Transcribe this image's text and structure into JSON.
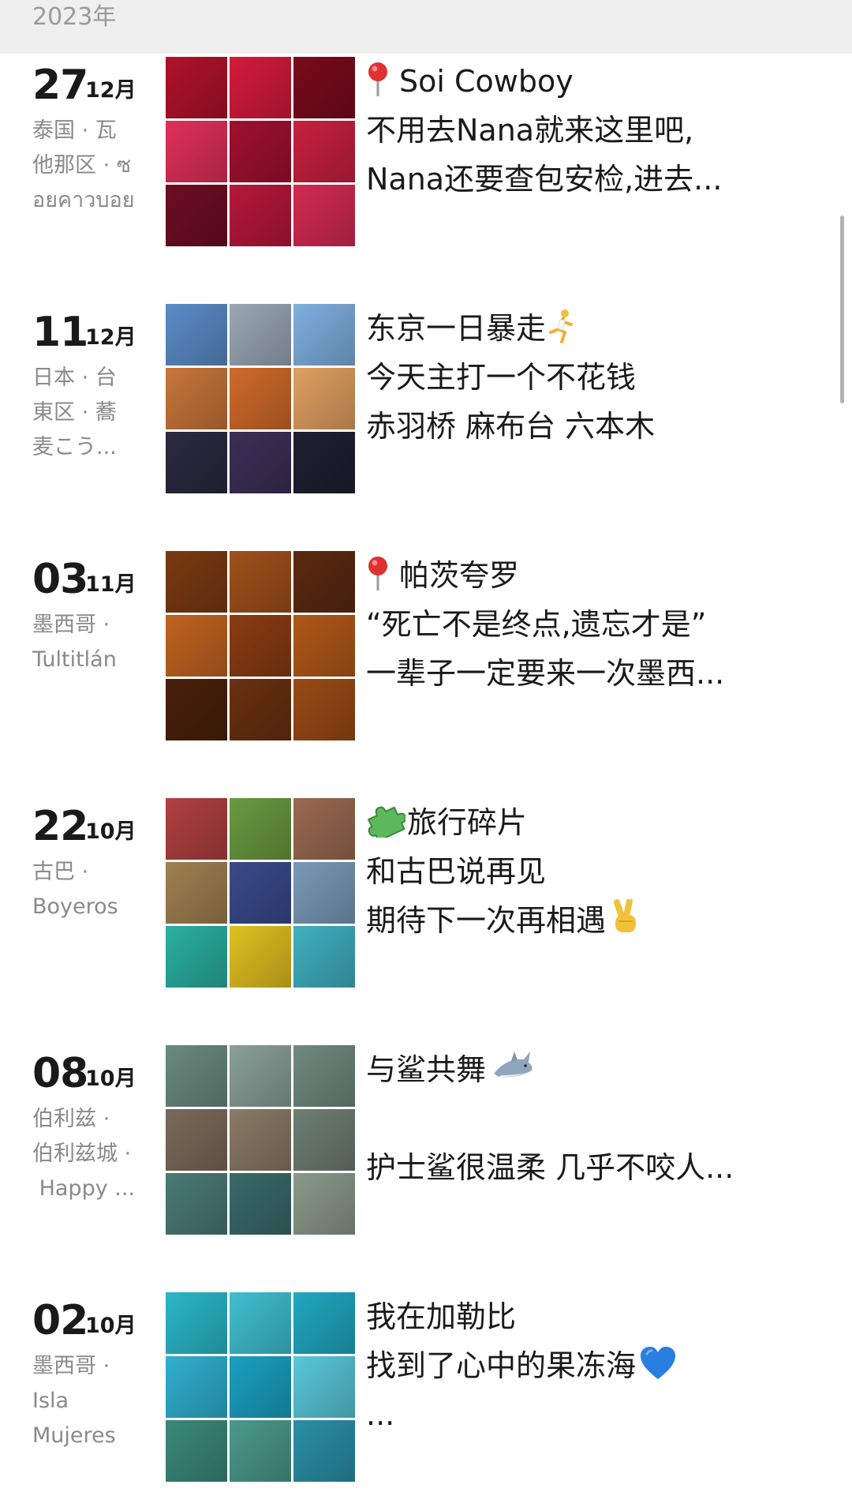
{
  "year_header": "2023年",
  "entries": [
    {
      "day": "27",
      "month": "12月",
      "location": [
        "泰国 · 瓦",
        "他那区 · ซ",
        "อยคาวบอย"
      ],
      "caption": [
        "Soi Cowboy",
        "不用去Nana就来这里吧,",
        "Nana还要查包安检,进去..."
      ],
      "caption_icon": "pin-icon",
      "photo_palette": [
        "#b0122a",
        "#d41a3c",
        "#7a0a1c",
        "#e0305a",
        "#a01030",
        "#c8203f",
        "#6e0d22",
        "#b6173a",
        "#d32a52"
      ]
    },
    {
      "day": "11",
      "month": "12月",
      "location": [
        "日本 · 台",
        "東区 · 蕎",
        "麦こう..."
      ],
      "caption": [
        "东京一日暴走",
        "今天主打一个不花钱",
        "赤羽桥 麻布台 六本木"
      ],
      "caption_icon": "runner-icon",
      "photo_palette": [
        "#5b8cc8",
        "#9aa7b5",
        "#7fb0e0",
        "#c8763a",
        "#d06a2a",
        "#e0a060",
        "#2a2a40",
        "#3b2f55",
        "#1e2030"
      ]
    },
    {
      "day": "03",
      "month": "11月",
      "location": [
        "墨西哥 ·",
        "Tultitlán"
      ],
      "caption": [
        "帕茨夸罗",
        "“死亡不是终点,遗忘才是”",
        "一辈子一定要来一次墨西..."
      ],
      "caption_icon": "pin-icon",
      "photo_palette": [
        "#7a3a10",
        "#a0501a",
        "#5a2a10",
        "#c06420",
        "#8a3c12",
        "#b05818",
        "#4a200a",
        "#6a3010",
        "#9a4a14"
      ]
    },
    {
      "day": "22",
      "month": "10月",
      "location": [
        "古巴 ·",
        "Boyeros"
      ],
      "caption": [
        "旅行碎片",
        "和古巴说再见",
        "期待下一次再相遇"
      ],
      "caption_icon": "puzzle-icon",
      "caption_tail_icon": "victory-hand-icon",
      "photo_palette": [
        "#b04040",
        "#6a9a40",
        "#9a6a50",
        "#a08050",
        "#3a4a8a",
        "#7a9ab8",
        "#2ab0a0",
        "#e0c020",
        "#40b0c0"
      ]
    },
    {
      "day": "08",
      "month": "10月",
      "location": [
        "伯利兹 ·",
        "伯利兹城 ·",
        " Happy ..."
      ],
      "caption": [
        "与鲨共舞",
        "",
        "护士鲨很温柔 几乎不咬人..."
      ],
      "caption_icon": "shark-icon",
      "photo_palette": [
        "#6a8a80",
        "#8aa098",
        "#708a7e",
        "#7a6a5a",
        "#8a7a66",
        "#6e7e72",
        "#4a7a76",
        "#3a6a6a",
        "#8a9a8a"
      ]
    },
    {
      "day": "02",
      "month": "10月",
      "location": [
        "墨西哥 ·",
        "Isla",
        "Mujeres"
      ],
      "caption": [
        "我在加勒比",
        "找到了心中的果冻海",
        "..."
      ],
      "caption_icon": "blue-heart-icon",
      "photo_palette": [
        "#2ab8c8",
        "#40c0d0",
        "#20a8c0",
        "#30b0d0",
        "#1aa0c0",
        "#58c8d8",
        "#3a8a7a",
        "#4a9a8a",
        "#2a90a8"
      ]
    }
  ]
}
